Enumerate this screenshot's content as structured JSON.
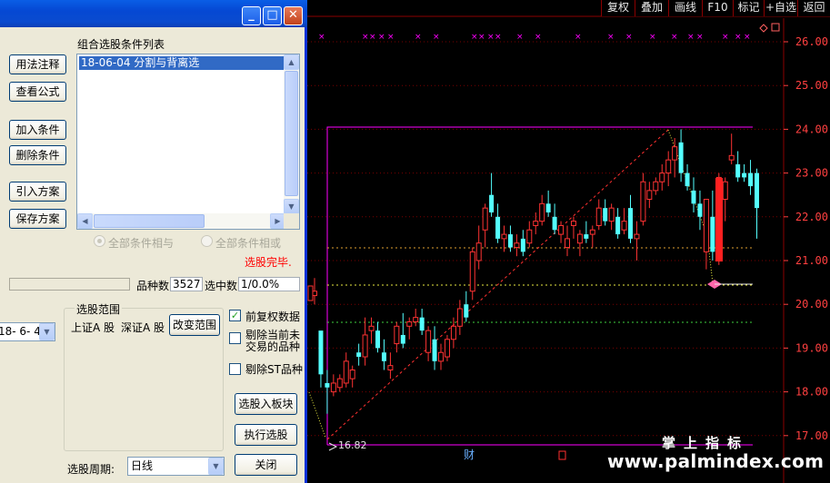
{
  "dialog": {
    "buttons_left": [
      "用法注释",
      "查看公式",
      "加入条件",
      "删除条件",
      "引入方案",
      "保存方案"
    ],
    "list_title": "组合选股条件列表",
    "list_items": [
      "18-06-04 分割与背离选"
    ],
    "radio_and": "全部条件相与",
    "radio_or": "全部条件相或",
    "status": "选股完毕.",
    "count_label": "品种数",
    "count_value": "3527",
    "selected_label": "选中数",
    "selected_value": "1/0.0%",
    "date_value": "18- 6- 4",
    "range_title": "选股范围",
    "range_markets": [
      "上证A 股",
      "深证A 股"
    ],
    "change_range": "改变范围",
    "options": [
      {
        "label": "前复权数据",
        "checked": true
      },
      {
        "label": "剔除当前未\n交易的品种",
        "checked": false
      },
      {
        "label": "剔除ST品种",
        "checked": false
      }
    ],
    "to_board": "选股入板块",
    "execute": "执行选股",
    "close": "关闭",
    "period_label": "选股周期:",
    "period_value": "日线"
  },
  "titlebar": {
    "minimize": "_",
    "maximize": "□",
    "close": "✕"
  },
  "toolbar": [
    "复权",
    "叠加",
    "画线",
    "F10",
    "标记",
    "+自选",
    "返回"
  ],
  "price_axis": [
    "26.00",
    "25.00",
    "24.00",
    "23.00",
    "22.00",
    "21.00",
    "20.00",
    "19.00",
    "18.00",
    "17.00"
  ],
  "low_label": "16.82",
  "marker_fin": "财",
  "watermark_cn": "掌上指标",
  "watermark_url": "www.palmindex.com",
  "colors": {
    "up": "#ff3333",
    "down": "#54ffff",
    "frame": "#ff00ff",
    "axis_text": "#ff4040",
    "grid": "#8b0000"
  },
  "chart_data": {
    "type": "candlestick",
    "y_range": [
      16.8,
      26.2
    ],
    "candles": [
      [
        20.2,
        20.6,
        20.0,
        20.3
      ],
      [
        19.4,
        19.3,
        18.1,
        18.4
      ],
      [
        18.2,
        18.5,
        17.5,
        18.1
      ],
      [
        18.0,
        18.4,
        17.9,
        18.2
      ],
      [
        18.1,
        18.4,
        18.0,
        18.3
      ],
      [
        18.2,
        18.9,
        18.1,
        18.7
      ],
      [
        18.3,
        18.6,
        18.1,
        18.5
      ],
      [
        18.9,
        19.1,
        18.6,
        18.8
      ],
      [
        18.8,
        19.7,
        18.6,
        19.3
      ],
      [
        19.4,
        19.7,
        19.1,
        19.5
      ],
      [
        19.4,
        19.6,
        18.9,
        19.0
      ],
      [
        18.9,
        19.2,
        18.5,
        18.7
      ],
      [
        18.5,
        18.9,
        18.3,
        18.6
      ],
      [
        19.1,
        19.6,
        18.9,
        19.5
      ],
      [
        19.3,
        19.8,
        19.0,
        19.1
      ],
      [
        19.5,
        19.7,
        19.2,
        19.6
      ],
      [
        19.6,
        19.9,
        19.5,
        19.7
      ],
      [
        19.7,
        19.9,
        19.3,
        19.4
      ],
      [
        18.9,
        19.5,
        18.7,
        19.4
      ],
      [
        19.2,
        19.5,
        18.5,
        18.7
      ],
      [
        18.7,
        19.1,
        18.5,
        18.9
      ],
      [
        18.8,
        19.3,
        18.7,
        19.2
      ],
      [
        19.2,
        19.7,
        19.0,
        19.5
      ],
      [
        19.5,
        20.1,
        19.3,
        19.9
      ],
      [
        20.0,
        20.3,
        19.6,
        19.7
      ],
      [
        20.3,
        21.3,
        20.1,
        21.2
      ],
      [
        21.0,
        21.8,
        20.8,
        21.4
      ],
      [
        21.7,
        22.3,
        21.3,
        22.2
      ],
      [
        22.5,
        23.0,
        22.0,
        22.1
      ],
      [
        22.0,
        22.3,
        21.4,
        21.5
      ],
      [
        21.5,
        21.8,
        21.2,
        21.6
      ],
      [
        21.6,
        21.8,
        21.2,
        21.3
      ],
      [
        21.3,
        21.6,
        21.1,
        21.4
      ],
      [
        21.5,
        21.7,
        21.1,
        21.2
      ],
      [
        21.4,
        21.9,
        21.3,
        21.7
      ],
      [
        21.8,
        22.1,
        21.6,
        21.9
      ],
      [
        21.9,
        22.5,
        21.8,
        22.3
      ],
      [
        22.3,
        22.6,
        22.0,
        22.1
      ],
      [
        22.0,
        22.3,
        21.6,
        21.7
      ],
      [
        21.6,
        21.9,
        21.4,
        21.8
      ],
      [
        21.3,
        21.8,
        21.1,
        21.5
      ],
      [
        21.8,
        22.0,
        21.5,
        21.9
      ],
      [
        21.4,
        21.7,
        21.1,
        21.6
      ],
      [
        21.6,
        21.9,
        21.4,
        21.5
      ],
      [
        21.6,
        21.8,
        21.3,
        21.7
      ],
      [
        21.8,
        22.4,
        21.7,
        22.2
      ],
      [
        22.2,
        22.4,
        21.8,
        21.9
      ],
      [
        21.9,
        22.3,
        21.7,
        22.2
      ],
      [
        22.0,
        22.2,
        21.5,
        21.6
      ],
      [
        21.7,
        22.2,
        21.6,
        21.9
      ],
      [
        22.2,
        22.5,
        21.4,
        21.5
      ],
      [
        21.5,
        21.9,
        21.0,
        21.6
      ],
      [
        21.9,
        23.0,
        21.8,
        22.8
      ],
      [
        22.4,
        22.8,
        22.2,
        22.6
      ],
      [
        22.6,
        22.9,
        22.5,
        22.8
      ],
      [
        22.8,
        23.2,
        22.6,
        23.0
      ],
      [
        23.0,
        23.5,
        22.7,
        23.3
      ],
      [
        23.3,
        23.8,
        22.9,
        23.6
      ],
      [
        23.7,
        24.0,
        22.8,
        23.0
      ],
      [
        23.0,
        23.2,
        22.6,
        22.7
      ],
      [
        22.6,
        22.9,
        22.1,
        22.3
      ],
      [
        22.3,
        22.6,
        21.7,
        22.0
      ],
      [
        21.2,
        22.4,
        20.8,
        22.4
      ],
      [
        22.0,
        22.6,
        21.0,
        21.2
      ],
      [
        21.0,
        23.0,
        20.9,
        22.9
      ],
      [
        22.4,
        22.9,
        21.9,
        22.8
      ],
      [
        23.3,
        23.9,
        23.2,
        23.4
      ],
      [
        23.2,
        23.5,
        22.8,
        22.9
      ],
      [
        23.0,
        23.2,
        22.8,
        22.9
      ],
      [
        23.0,
        23.3,
        22.5,
        22.7
      ],
      [
        23.0,
        23.1,
        21.5,
        22.2
      ]
    ]
  }
}
